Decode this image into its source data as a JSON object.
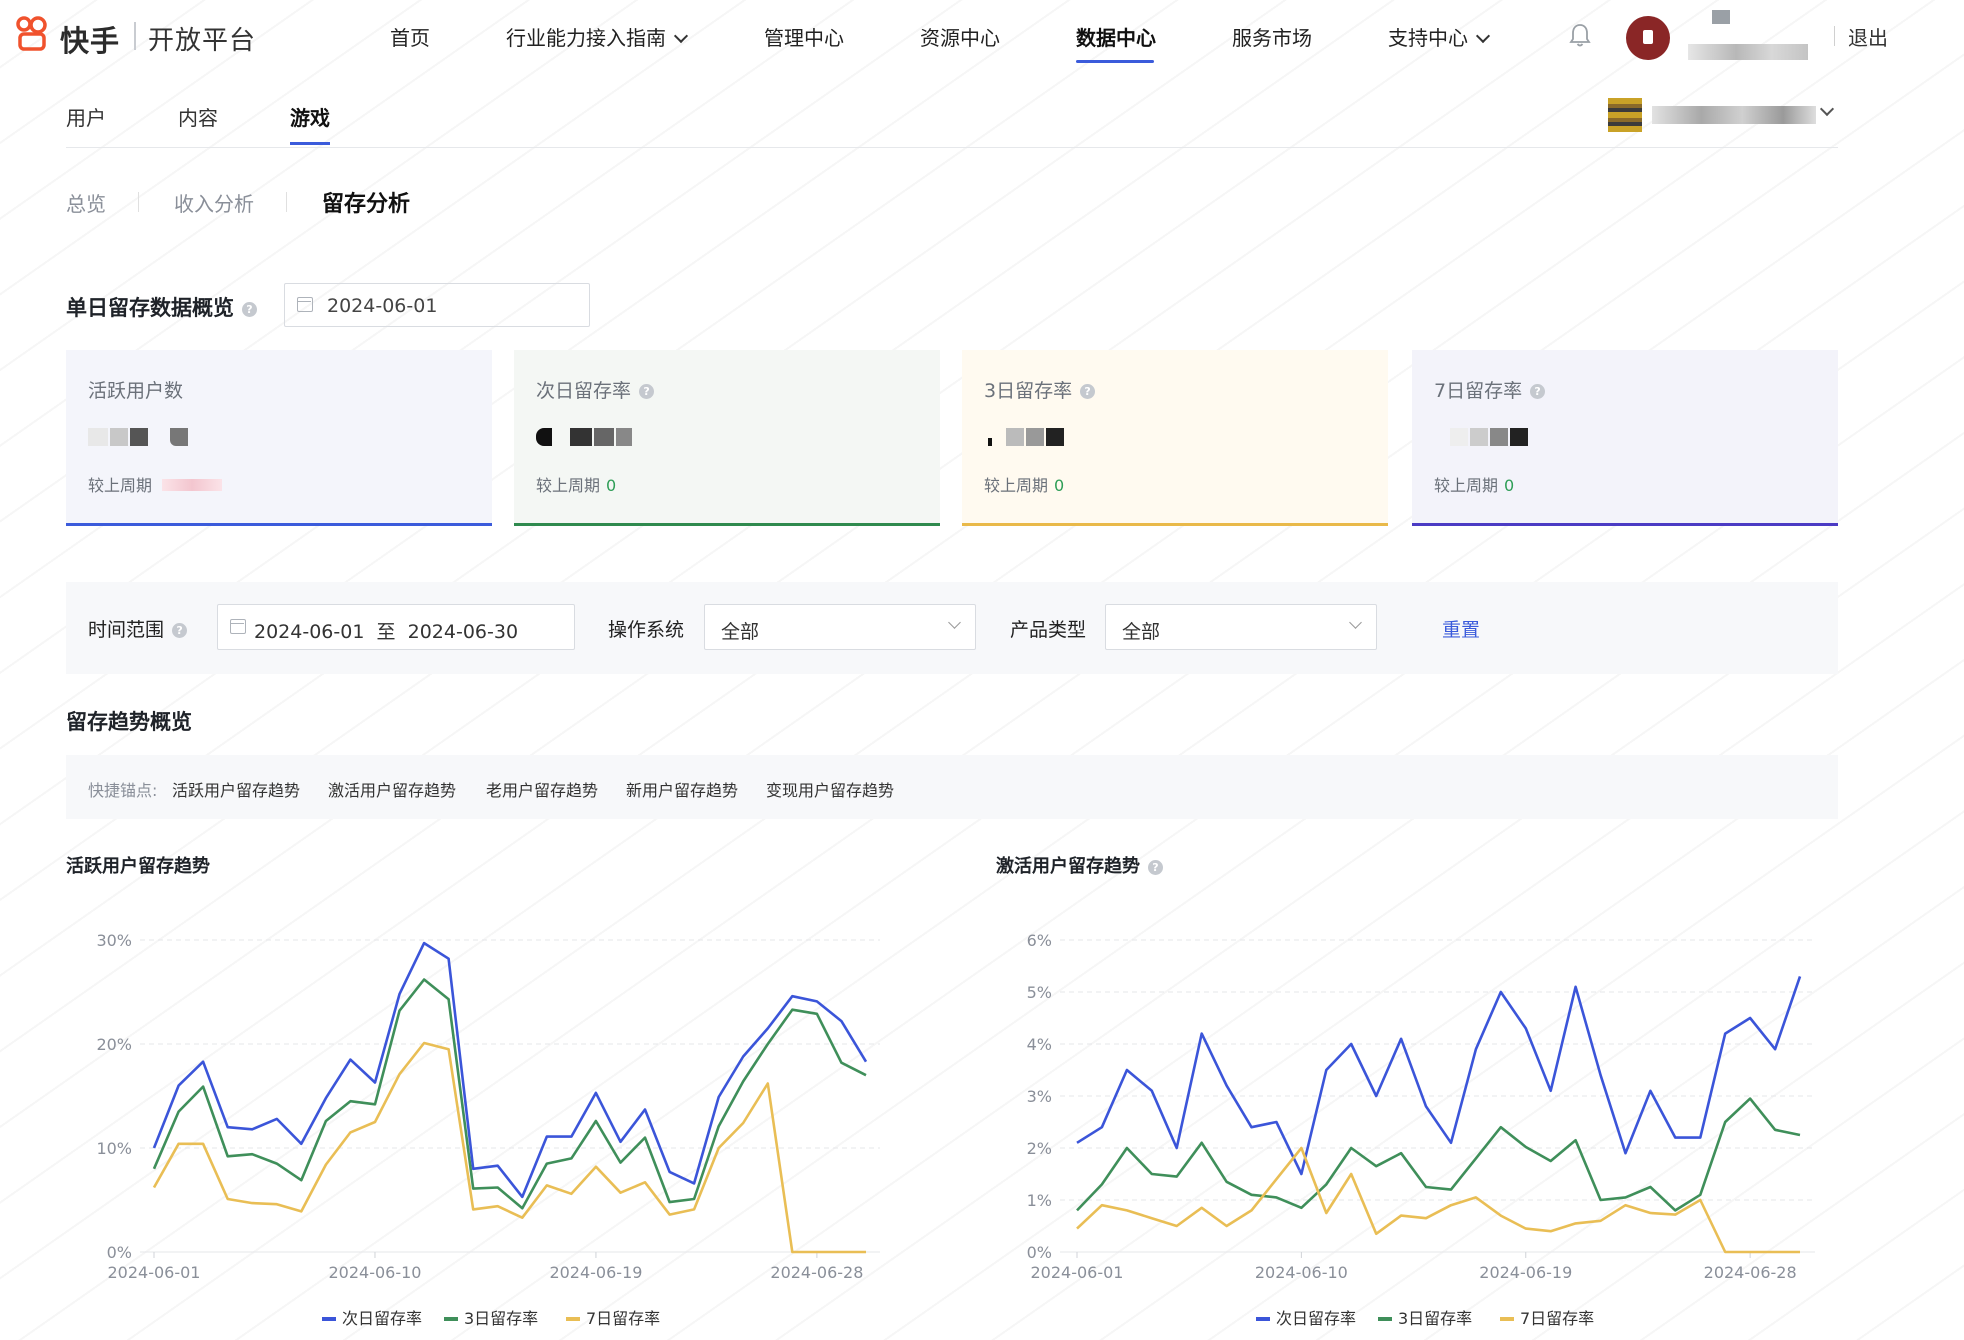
{
  "brand": {
    "name": "快手",
    "sub": "开放平台"
  },
  "nav": {
    "items": [
      {
        "label": "首页"
      },
      {
        "label": "行业能力接入指南"
      },
      {
        "label": "管理中心"
      },
      {
        "label": "资源中心"
      },
      {
        "label": "数据中心",
        "active": true
      },
      {
        "label": "服务市场"
      },
      {
        "label": "支持中心"
      }
    ],
    "exit": "退出"
  },
  "tabs": [
    {
      "label": "用户"
    },
    {
      "label": "内容"
    },
    {
      "label": "游戏",
      "active": true
    }
  ],
  "subtabs": [
    {
      "label": "总览"
    },
    {
      "label": "收入分析"
    },
    {
      "label": "留存分析",
      "active": true
    }
  ],
  "single_day": {
    "title": "单日留存数据概览",
    "date": "2024-06-01"
  },
  "cards": [
    {
      "label": "活跃用户数",
      "compare_label": "较上周期",
      "compare_value": "",
      "color": "#3b5bdb",
      "bg": "#f4f5fb"
    },
    {
      "label": "次日留存率",
      "compare_label": "较上周期",
      "compare_value": "0",
      "color": "#2f8a4e",
      "bg": "#f4f7f4"
    },
    {
      "label": "3日留存率",
      "compare_label": "较上周期",
      "compare_value": "0",
      "color": "#e9b949",
      "bg": "#fffaf0"
    },
    {
      "label": "7日留存率",
      "compare_label": "较上周期",
      "compare_value": "0",
      "color": "#4b3bc4",
      "bg": "#f3f3fa"
    }
  ],
  "filters": {
    "time_label": "时间范围",
    "start": "2024-06-01",
    "to": "至",
    "end": "2024-06-30",
    "os_label": "操作系统",
    "os_value": "全部",
    "product_label": "产品类型",
    "product_value": "全部",
    "reset": "重置"
  },
  "trend": {
    "title": "留存趋势概览",
    "anchor_prefix": "快捷锚点:",
    "anchors": [
      "活跃用户留存趋势",
      "激活用户留存趋势",
      "老用户留存趋势",
      "新用户留存趋势",
      "变现用户留存趋势"
    ]
  },
  "chart_data": [
    {
      "type": "line",
      "title": "活跃用户留存趋势",
      "x": [
        "2024-06-01",
        "2024-06-02",
        "2024-06-03",
        "2024-06-04",
        "2024-06-05",
        "2024-06-06",
        "2024-06-07",
        "2024-06-08",
        "2024-06-09",
        "2024-06-10",
        "2024-06-11",
        "2024-06-12",
        "2024-06-13",
        "2024-06-14",
        "2024-06-15",
        "2024-06-16",
        "2024-06-17",
        "2024-06-18",
        "2024-06-19",
        "2024-06-20",
        "2024-06-21",
        "2024-06-22",
        "2024-06-23",
        "2024-06-24",
        "2024-06-25",
        "2024-06-26",
        "2024-06-27",
        "2024-06-28",
        "2024-06-29",
        "2024-06-30"
      ],
      "x_ticks": [
        "2024-06-01",
        "2024-06-10",
        "2024-06-19",
        "2024-06-28"
      ],
      "y_ticks": [
        "0%",
        "10%",
        "20%",
        "30%"
      ],
      "ylim": [
        0,
        30
      ],
      "series": [
        {
          "name": "次日留存率",
          "color": "#3b55d9",
          "values": [
            10,
            16,
            18.3,
            12,
            11.8,
            12.8,
            10.4,
            14.8,
            18.5,
            16.3,
            24.8,
            29.7,
            28.2,
            8,
            8.3,
            5.3,
            11.1,
            11.1,
            15.3,
            10.6,
            13.7,
            7.7,
            6.6,
            14.9,
            18.8,
            21.5,
            24.6,
            24.1,
            22.2,
            18.3
          ]
        },
        {
          "name": "3日留存率",
          "color": "#3f8f5a",
          "values": [
            8,
            13.5,
            15.9,
            9.2,
            9.4,
            8.5,
            6.9,
            12.6,
            14.5,
            14.2,
            23.2,
            26.2,
            24.3,
            6.1,
            6.2,
            4.2,
            8.5,
            9,
            12.6,
            8.6,
            11,
            4.8,
            5.1,
            12.1,
            16.4,
            20,
            23.3,
            22.9,
            18.2,
            17
          ]
        },
        {
          "name": "7日留存率",
          "color": "#e9be55",
          "values": [
            6.2,
            10.4,
            10.4,
            5.1,
            4.7,
            4.6,
            3.9,
            8.4,
            11.5,
            12.5,
            17.1,
            20.1,
            19.5,
            4.1,
            4.4,
            3.3,
            6.4,
            5.6,
            8.2,
            5.7,
            6.7,
            3.6,
            4.1,
            10,
            12.4,
            16.2,
            0,
            0,
            0,
            0
          ]
        }
      ]
    },
    {
      "type": "line",
      "title": "激活用户留存趋势",
      "x": [
        "2024-06-01",
        "2024-06-02",
        "2024-06-03",
        "2024-06-04",
        "2024-06-05",
        "2024-06-06",
        "2024-06-07",
        "2024-06-08",
        "2024-06-09",
        "2024-06-10",
        "2024-06-11",
        "2024-06-12",
        "2024-06-13",
        "2024-06-14",
        "2024-06-15",
        "2024-06-16",
        "2024-06-17",
        "2024-06-18",
        "2024-06-19",
        "2024-06-20",
        "2024-06-21",
        "2024-06-22",
        "2024-06-23",
        "2024-06-24",
        "2024-06-25",
        "2024-06-26",
        "2024-06-27",
        "2024-06-28",
        "2024-06-29",
        "2024-06-30"
      ],
      "x_ticks": [
        "2024-06-01",
        "2024-06-10",
        "2024-06-19",
        "2024-06-28"
      ],
      "y_ticks": [
        "0%",
        "1%",
        "2%",
        "3%",
        "4%",
        "5%",
        "6%"
      ],
      "ylim": [
        0,
        6
      ],
      "series": [
        {
          "name": "次日留存率",
          "color": "#3b55d9",
          "values": [
            2.1,
            2.4,
            3.5,
            3.1,
            2,
            4.2,
            3.2,
            2.4,
            2.5,
            1.5,
            3.5,
            4,
            3,
            4.1,
            2.8,
            2.1,
            3.9,
            5,
            4.3,
            3.1,
            5.1,
            3.4,
            1.9,
            3.1,
            2.2,
            2.2,
            4.2,
            4.5,
            3.9,
            5.3
          ]
        },
        {
          "name": "3日留存率",
          "color": "#3f8f5a",
          "values": [
            0.8,
            1.3,
            2,
            1.5,
            1.45,
            2.1,
            1.35,
            1.1,
            1.05,
            0.85,
            1.3,
            2,
            1.65,
            1.9,
            1.25,
            1.2,
            1.8,
            2.4,
            2.02,
            1.75,
            2.15,
            1,
            1.05,
            1.25,
            0.8,
            1.1,
            2.5,
            2.95,
            2.35,
            2.25
          ]
        },
        {
          "name": "7日留存率",
          "color": "#e9be55",
          "values": [
            0.45,
            0.9,
            0.8,
            0.65,
            0.5,
            0.85,
            0.5,
            0.8,
            1.4,
            2,
            0.75,
            1.5,
            0.35,
            0.7,
            0.65,
            0.9,
            1.05,
            0.7,
            0.45,
            0.4,
            0.55,
            0.6,
            0.9,
            0.75,
            0.72,
            1,
            0,
            0,
            0,
            0
          ]
        }
      ]
    }
  ]
}
